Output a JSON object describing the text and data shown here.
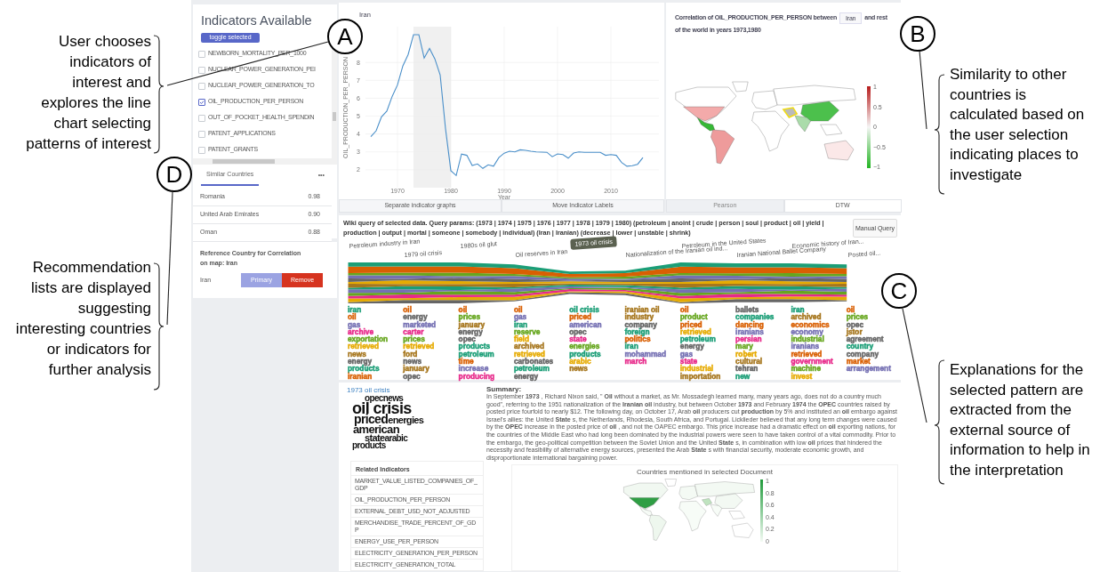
{
  "annotations_left": [
    {
      "lines": [
        "User chooses",
        "indicators of",
        "interest and",
        "explores the line",
        "chart selecting",
        "patterns of interest"
      ]
    },
    {
      "lines": [
        "Recommendation",
        "lists are displayed",
        "suggesting",
        "interesting countries",
        "or indicators for",
        "further analysis"
      ]
    }
  ],
  "annotations_right": [
    {
      "lines": [
        "Similarity to other",
        "countries is",
        "calculated based on",
        "the user selection",
        "indicating places to",
        "investigate"
      ]
    },
    {
      "lines": [
        "Explanations for the",
        "selected pattern are",
        "extracted from the",
        "external source of",
        "information to help in",
        "the interpretation"
      ]
    }
  ],
  "callouts": [
    {
      "label": "A"
    },
    {
      "label": "B"
    },
    {
      "label": "C"
    },
    {
      "label": "D"
    }
  ],
  "indicators": {
    "title": "Indicators Available",
    "toggle_button": "toggle selected",
    "items": [
      {
        "label": "NEWBORN_MORTALITY_PER_1000",
        "checked": false
      },
      {
        "label": "NUCLEAR_POWER_GENERATION_PEI",
        "checked": false
      },
      {
        "label": "NUCLEAR_POWER_GENERATION_TO",
        "checked": false
      },
      {
        "label": "OIL_PRODUCTION_PER_PERSON",
        "checked": true
      },
      {
        "label": "OUT_OF_POCKET_HEALTH_SPENDIN",
        "checked": false
      },
      {
        "label": "PATENT_APPLICATIONS",
        "checked": false
      },
      {
        "label": "PATENT_GRANTS",
        "checked": false
      }
    ]
  },
  "similar": {
    "tabs": [
      {
        "label": "Similar Countries",
        "selected": true
      }
    ],
    "more": "•••",
    "rows": [
      {
        "country": "Romania",
        "score": "0.98"
      },
      {
        "country": "United Arab Emirates",
        "score": "0.90"
      },
      {
        "country": "Oman",
        "score": "0.88"
      }
    ]
  },
  "reference": {
    "title": "Reference Country for Correlation on map: Iran",
    "country": "Iran",
    "buttons": [
      {
        "label": "Primary",
        "kind": "primary",
        "disabled": true
      },
      {
        "label": "Remove",
        "kind": "danger",
        "disabled": false
      }
    ]
  },
  "line_chart": {
    "buttons": [
      "Separate indicator graphs",
      "Move Indicator Labels"
    ],
    "chart_data": {
      "type": "line",
      "title": "Iran",
      "xlabel": "Year",
      "ylabel": "OIL_PRODUCTION_PER_PERSON",
      "x": [
        1965,
        1966,
        1967,
        1968,
        1969,
        1970,
        1971,
        1972,
        1973,
        1974,
        1975,
        1976,
        1977,
        1978,
        1979,
        1980,
        1981,
        1982,
        1983,
        1984,
        1985,
        1986,
        1987,
        1988,
        1989,
        1990,
        1991,
        1992,
        1993,
        1994,
        1995,
        1996,
        1997,
        1998,
        1999,
        2000,
        2001,
        2002,
        2003,
        2004,
        2005,
        2006,
        2007,
        2008,
        2009,
        2010,
        2011,
        2012,
        2013,
        2014,
        2015,
        2016
      ],
      "series": [
        {
          "color": "#4a8fc9",
          "values": [
            3.85,
            4.18,
            4.96,
            5.28,
            6.1,
            6.75,
            7.8,
            8.45,
            9.55,
            9.55,
            8.25,
            8.78,
            8.2,
            7.3,
            4.3,
            1.95,
            1.68,
            2.88,
            2.81,
            2.24,
            2.33,
            2.08,
            2.28,
            2.2,
            2.68,
            2.93,
            3.04,
            3.0,
            3.12,
            3.09,
            3.04,
            3.0,
            2.99,
            2.98,
            2.73,
            2.89,
            2.85,
            2.65,
            2.94,
            3.0,
            2.98,
            2.98,
            2.98,
            2.98,
            2.81,
            2.85,
            2.81,
            2.41,
            2.2,
            2.23,
            2.31,
            2.68
          ]
        }
      ],
      "xlim": [
        1964,
        2019
      ],
      "ylim": [
        1,
        10
      ],
      "grid": true,
      "xticks": [
        1970,
        1980,
        1990,
        2000,
        2010
      ],
      "yticks": [
        2,
        3,
        4,
        5,
        6,
        7,
        8
      ],
      "bands": [
        {
          "axis": "x",
          "from": 1973,
          "to": 1980
        }
      ]
    }
  },
  "correlation_map": {
    "caption_before": "Correlation of OIL_PRODUCTION_PER_PERSON between",
    "country": "Iran",
    "caption_after": [
      "and rest",
      "of the world in years 1973,1980"
    ],
    "colorbar": [
      "1",
      "0.5",
      "0",
      "−0.5",
      "−1"
    ],
    "methods": [
      {
        "label": "Pearson",
        "selected": true
      },
      {
        "label": "DTW",
        "selected": false
      }
    ]
  },
  "wiki": {
    "query": "Wiki query of selected data. Query params: (1973 | 1974 | 1975 | 1976 | 1977 | 1978 | 1979 | 1980) (petroleum | anoint | crude | person | soul | product | oil | yield | production | output | mortal | someone | somebody | individual) (Iran | Iranian) (decrease | lower | unstable | shrink)",
    "manual_button": "Manual Query",
    "topics": [
      {
        "label": "Petroleum industry in Iran",
        "selected": false,
        "words": [
          {
            "text": "iran",
            "color": "#1b9e77"
          },
          {
            "text": "oil",
            "color": "#d95f02"
          },
          {
            "text": "gas",
            "color": "#7570b3"
          },
          {
            "text": "archive",
            "color": "#e7298a"
          },
          {
            "text": "exportation",
            "color": "#66a61e"
          },
          {
            "text": "retrieved",
            "color": "#e6ab02"
          },
          {
            "text": "news",
            "color": "#a6761d"
          },
          {
            "text": "energy",
            "color": "#666666"
          },
          {
            "text": "products",
            "color": "#1b9e77"
          },
          {
            "text": "iranian",
            "color": "#d95f02"
          }
        ]
      },
      {
        "label": "1979 oil crisis",
        "selected": false,
        "words": [
          {
            "text": "oil",
            "color": "#d95f02"
          },
          {
            "text": "energy",
            "color": "#666666"
          },
          {
            "text": "marketed",
            "color": "#7570b3"
          },
          {
            "text": "carter",
            "color": "#e7298a"
          },
          {
            "text": "prices",
            "color": "#66a61e"
          },
          {
            "text": "retrieved",
            "color": "#e6ab02"
          },
          {
            "text": "ford",
            "color": "#a6761d"
          },
          {
            "text": "news",
            "color": "#666666"
          },
          {
            "text": "january",
            "color": "#a6761d"
          },
          {
            "text": "opec",
            "color": "#666666"
          }
        ]
      },
      {
        "label": "1980s oil glut",
        "selected": false,
        "words": [
          {
            "text": "oil",
            "color": "#d95f02"
          },
          {
            "text": "prices",
            "color": "#66a61e"
          },
          {
            "text": "january",
            "color": "#a6761d"
          },
          {
            "text": "energy",
            "color": "#666666"
          },
          {
            "text": "opec",
            "color": "#666666"
          },
          {
            "text": "products",
            "color": "#1b9e77"
          },
          {
            "text": "petroleum",
            "color": "#1b9e77"
          },
          {
            "text": "time",
            "color": "#d95f02"
          },
          {
            "text": "increase",
            "color": "#7570b3"
          },
          {
            "text": "producing",
            "color": "#e7298a"
          }
        ]
      },
      {
        "label": "Oil reserves in Iran",
        "selected": false,
        "words": [
          {
            "text": "oil",
            "color": "#d95f02"
          },
          {
            "text": "gas",
            "color": "#7570b3"
          },
          {
            "text": "iran",
            "color": "#1b9e77"
          },
          {
            "text": "reserve",
            "color": "#66a61e"
          },
          {
            "text": "field",
            "color": "#e6ab02"
          },
          {
            "text": "archived",
            "color": "#a6761d"
          },
          {
            "text": "retrieved",
            "color": "#e6ab02"
          },
          {
            "text": "carbonates",
            "color": "#666666"
          },
          {
            "text": "petroleum",
            "color": "#1b9e77"
          },
          {
            "text": "energy",
            "color": "#666666"
          }
        ]
      },
      {
        "label": "1973 oil crisis",
        "selected": true,
        "words": [
          {
            "text": "oil crisis",
            "color": "#1b9e77"
          },
          {
            "text": "priced",
            "color": "#d95f02"
          },
          {
            "text": "american",
            "color": "#7570b3"
          },
          {
            "text": "opec",
            "color": "#666666"
          },
          {
            "text": "state",
            "color": "#e7298a"
          },
          {
            "text": "energies",
            "color": "#66a61e"
          },
          {
            "text": "products",
            "color": "#1b9e77"
          },
          {
            "text": "arabic",
            "color": "#e6ab02"
          },
          {
            "text": "news",
            "color": "#a6761d"
          }
        ]
      },
      {
        "label": "Nationalization of the Iranian oil ind...",
        "selected": false,
        "words": [
          {
            "text": "iranian oil industry",
            "color": "#a6761d"
          },
          {
            "text": "company",
            "color": "#666666"
          },
          {
            "text": "foreign",
            "color": "#1b9e77"
          },
          {
            "text": "politics",
            "color": "#d95f02"
          },
          {
            "text": "iran",
            "color": "#1b9e77"
          },
          {
            "text": "mohammad",
            "color": "#7570b3"
          },
          {
            "text": "march",
            "color": "#e7298a"
          }
        ]
      },
      {
        "label": "Petroleum in the United States",
        "selected": false,
        "words": [
          {
            "text": "oil",
            "color": "#d95f02"
          },
          {
            "text": "product",
            "color": "#66a61e"
          },
          {
            "text": "priced",
            "color": "#d95f02"
          },
          {
            "text": "retrieved",
            "color": "#e6ab02"
          },
          {
            "text": "petroleum",
            "color": "#1b9e77"
          },
          {
            "text": "energy",
            "color": "#666666"
          },
          {
            "text": "gas",
            "color": "#7570b3"
          },
          {
            "text": "state",
            "color": "#e7298a"
          },
          {
            "text": "industrial",
            "color": "#e6ab02"
          },
          {
            "text": "importation",
            "color": "#a6761d"
          }
        ]
      },
      {
        "label": "Iranian National Ballet Company",
        "selected": false,
        "words": [
          {
            "text": "ballets",
            "color": "#666666"
          },
          {
            "text": "companies",
            "color": "#1b9e77"
          },
          {
            "text": "dancing",
            "color": "#d95f02"
          },
          {
            "text": "iranians",
            "color": "#7570b3"
          },
          {
            "text": "persian",
            "color": "#e7298a"
          },
          {
            "text": "mary",
            "color": "#66a61e"
          },
          {
            "text": "robert",
            "color": "#e6ab02"
          },
          {
            "text": "cultural",
            "color": "#a6761d"
          },
          {
            "text": "tehran",
            "color": "#666666"
          },
          {
            "text": "new",
            "color": "#1b9e77"
          }
        ]
      },
      {
        "label": "Economic history of Iran...",
        "selected": false,
        "words": [
          {
            "text": "iran",
            "color": "#1b9e77"
          },
          {
            "text": "archived",
            "color": "#a6761d"
          },
          {
            "text": "economics",
            "color": "#d95f02"
          },
          {
            "text": "economy",
            "color": "#7570b3"
          },
          {
            "text": "industrial",
            "color": "#66a61e"
          },
          {
            "text": "iranians",
            "color": "#7570b3"
          },
          {
            "text": "retrieved",
            "color": "#d95f02"
          },
          {
            "text": "government",
            "color": "#e7298a"
          },
          {
            "text": "machine",
            "color": "#66a61e"
          },
          {
            "text": "invest",
            "color": "#e6ab02"
          }
        ]
      },
      {
        "label": "Posted oil...",
        "selected": false,
        "words": [
          {
            "text": "oil",
            "color": "#d95f02"
          },
          {
            "text": "prices",
            "color": "#66a61e"
          },
          {
            "text": "opec",
            "color": "#666666"
          },
          {
            "text": "jstor",
            "color": "#a6761d"
          },
          {
            "text": "agreement",
            "color": "#666666"
          },
          {
            "text": "country",
            "color": "#1b9e77"
          },
          {
            "text": "company",
            "color": "#666666"
          },
          {
            "text": "market",
            "color": "#d95f02"
          },
          {
            "text": "arrangement",
            "color": "#7570b3"
          }
        ]
      }
    ]
  },
  "document": {
    "title": "1973 oil crisis",
    "word_cloud": [
      [
        "opec",
        "news"
      ],
      [
        "oil crisis"
      ],
      [
        "priced",
        "energies"
      ],
      [
        "american"
      ],
      [
        "state",
        "arabic"
      ],
      [
        "products"
      ]
    ],
    "summary_title": "Summary:",
    "summary": "In September **1973** , Richard Nixon said, \" **Oil** without a market, as Mr. Mossadegh learned many, many years ago, does not do a country much good\", referring to the 1951 nationalization of the **Iranian** **oil** industry, but between October **1973** and February **1974** the **OPEC** countries raised by posted price fourfold to nearly $12. The following day, on October 17, Arab **oil** producers cut **production** by 5% and instituted an **oil** embargo against Israel's allies: the United **State** s, the Netherlands, Rhodesia, South Africa, and Portugal. Licklieder believed that any long term changes were caused by the **OPEC** increase in the posted price of **oil** , and not the OAPEC embargo. This price increase had a dramatic effect on **oil** exporting nations, for the countries of the Middle East who had long been dominated by the industrial powers were seen to have taken control of a vital commodity. Prior to the embargo, the geo-political competition between the Soviet Union and the United **State** s, in combination with low **oil** prices that hindered the necessity and feasibility of alternative energy sources, presented the Arab **State** s with financial security, moderate economic growth, and disproportionate international bargaining power.",
    "related_title": "Related Indicators",
    "related": [
      "MARKET_VALUE_LISTED_COMPANIES_OF_GDP",
      "OIL_PRODUCTION_PER_PERSON",
      "EXTERNAL_DEBT_USD_NOT_ADJUSTED",
      "MERCHANDISE_TRADE_PERCENT_OF_GDP",
      "ENERGY_USE_PER_PERSON",
      "ELECTRICITY_GENERATION_PER_PERSON",
      "ELECTRICITY_GENERATION_TOTAL"
    ],
    "map_title": "Countries mentioned in selected Document",
    "colorbar": [
      "1",
      "0.8",
      "0.6",
      "0.4",
      "0.2",
      "0"
    ]
  }
}
